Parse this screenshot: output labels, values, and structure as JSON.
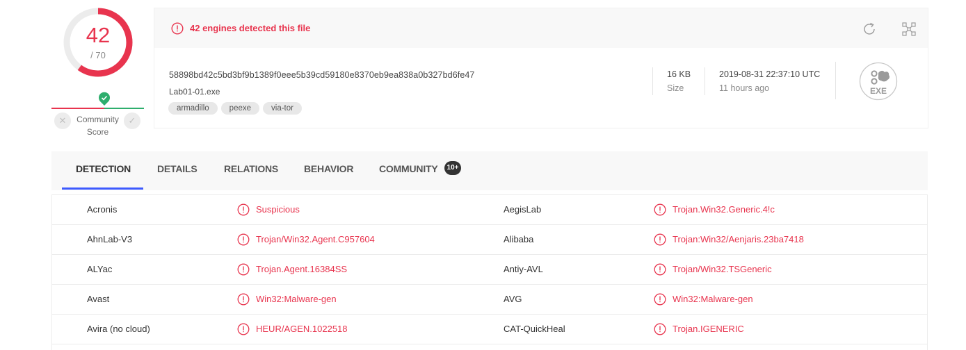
{
  "score": {
    "detected": "42",
    "total": "/ 70",
    "detected_fraction": 0.6
  },
  "community": {
    "label": "Community Score",
    "dislike_icon": "x-icon",
    "like_icon": "check-icon"
  },
  "header": {
    "alert_text": "42 engines detected this file",
    "reanalyze_icon": "reanalyze-icon",
    "graph_icon": "graph-icon"
  },
  "file": {
    "hash": "58898bd42c5bd3bf9b1389f0eee5b39cd59180e8370eb9ea838a0b327bd6fe47",
    "name": "Lab01-01.exe",
    "tags": [
      "armadillo",
      "peexe",
      "via-tor"
    ],
    "size_value": "16 KB",
    "size_label": "Size",
    "date_value": "2019-08-31 22:37:10 UTC",
    "date_relative": "11 hours ago",
    "type_label": "EXE"
  },
  "tabs": [
    {
      "label": "DETECTION",
      "active": true
    },
    {
      "label": "DETAILS",
      "active": false
    },
    {
      "label": "RELATIONS",
      "active": false
    },
    {
      "label": "BEHAVIOR",
      "active": false
    },
    {
      "label": "COMMUNITY",
      "active": false,
      "badge": "10+"
    }
  ],
  "detections": [
    {
      "left_engine": "Acronis",
      "left_result": "Suspicious",
      "right_engine": "AegisLab",
      "right_result": "Trojan.Win32.Generic.4!c"
    },
    {
      "left_engine": "AhnLab-V3",
      "left_result": "Trojan/Win32.Agent.C957604",
      "right_engine": "Alibaba",
      "right_result": "Trojan:Win32/Aenjaris.23ba7418"
    },
    {
      "left_engine": "ALYac",
      "left_result": "Trojan.Agent.16384SS",
      "right_engine": "Antiy-AVL",
      "right_result": "Trojan/Win32.TSGeneric"
    },
    {
      "left_engine": "Avast",
      "left_result": "Win32:Malware-gen",
      "right_engine": "AVG",
      "right_result": "Win32:Malware-gen"
    },
    {
      "left_engine": "Avira (no cloud)",
      "left_result": "HEUR/AGEN.1022518",
      "right_engine": "CAT-QuickHeal",
      "right_result": "Trojan.IGENERIC"
    }
  ],
  "colors": {
    "danger": "#e8344e",
    "safe": "#2eae6d",
    "accent": "#3d5afe"
  }
}
